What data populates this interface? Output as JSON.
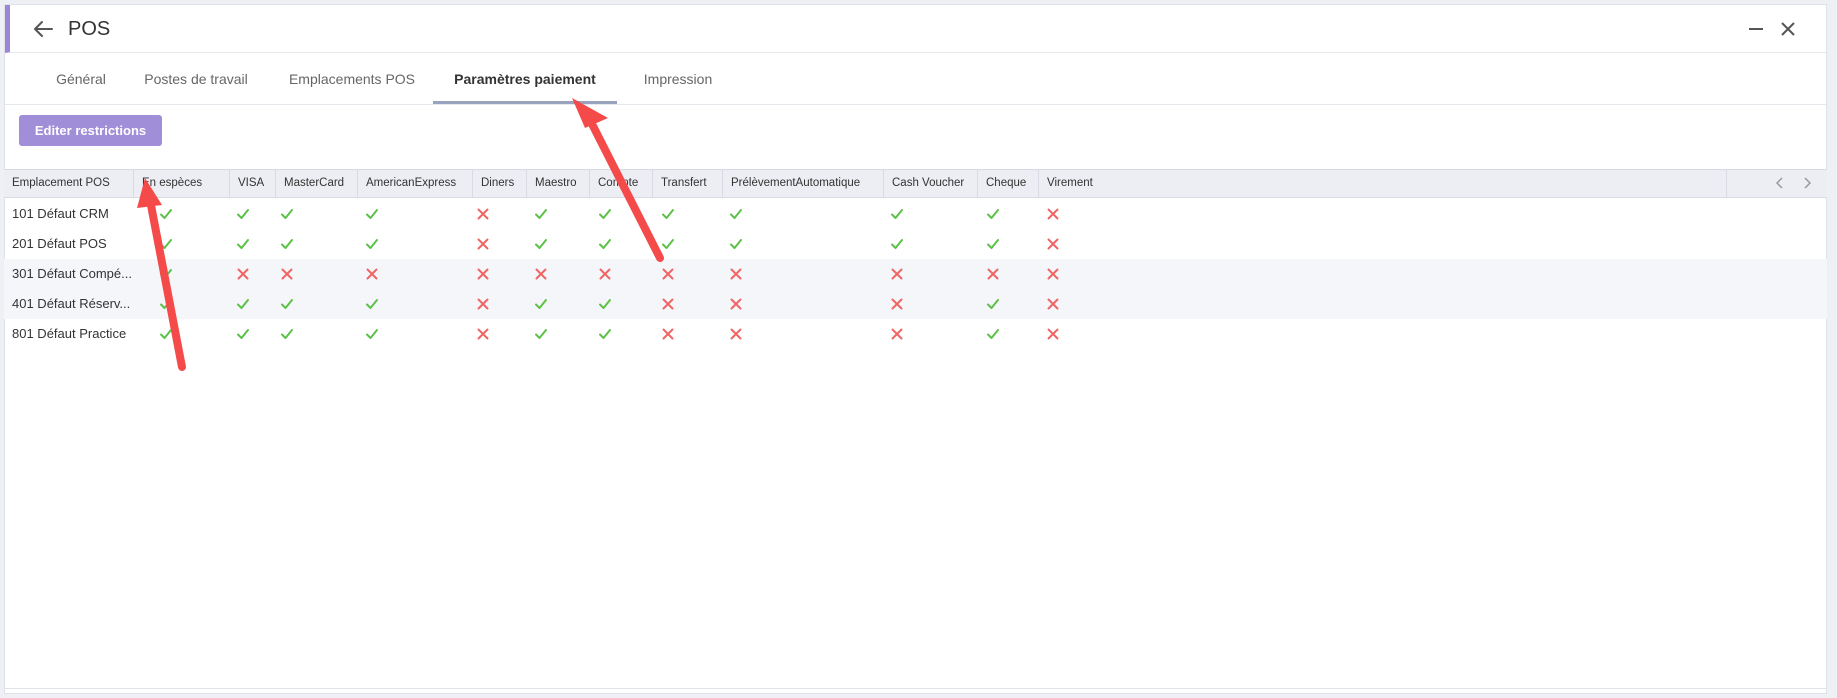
{
  "window": {
    "title": "POS"
  },
  "tabs": [
    {
      "label": "Général"
    },
    {
      "label": "Postes de travail"
    },
    {
      "label": "Emplacements POS"
    },
    {
      "label": "Paramètres paiement"
    },
    {
      "label": "Impression"
    }
  ],
  "active_tab": "Paramètres paiement",
  "toolbar": {
    "edit_label": "Editer restrictions"
  },
  "grid": {
    "columns": [
      "Emplacement POS",
      "En espèces",
      "VISA",
      "MasterCard",
      "AmericanExpress",
      "Diners",
      "Maestro",
      "Compte",
      "Transfert",
      "PrélèvementAutomatique",
      "Cash Voucher",
      "Cheque",
      "Virement"
    ],
    "rows": [
      {
        "name": "101 Défaut CRM",
        "values": [
          true,
          true,
          true,
          true,
          false,
          true,
          true,
          true,
          true,
          true,
          true,
          false
        ]
      },
      {
        "name": "201 Défaut POS",
        "values": [
          true,
          true,
          true,
          true,
          false,
          true,
          true,
          true,
          true,
          true,
          true,
          false
        ]
      },
      {
        "name": "301 Défaut Compé...",
        "values": [
          true,
          false,
          false,
          false,
          false,
          false,
          false,
          false,
          false,
          false,
          false,
          false
        ]
      },
      {
        "name": "401 Défaut Réserv...",
        "values": [
          true,
          true,
          true,
          true,
          false,
          true,
          true,
          false,
          false,
          false,
          true,
          false
        ]
      },
      {
        "name": "801 Défaut Practice",
        "values": [
          true,
          true,
          true,
          true,
          false,
          true,
          true,
          false,
          false,
          false,
          true,
          false
        ]
      }
    ]
  },
  "colors": {
    "accent": "#a18ed8",
    "check": "#5cc148",
    "cross": "#f06464",
    "annotation_arrow": "#f44a4a"
  }
}
